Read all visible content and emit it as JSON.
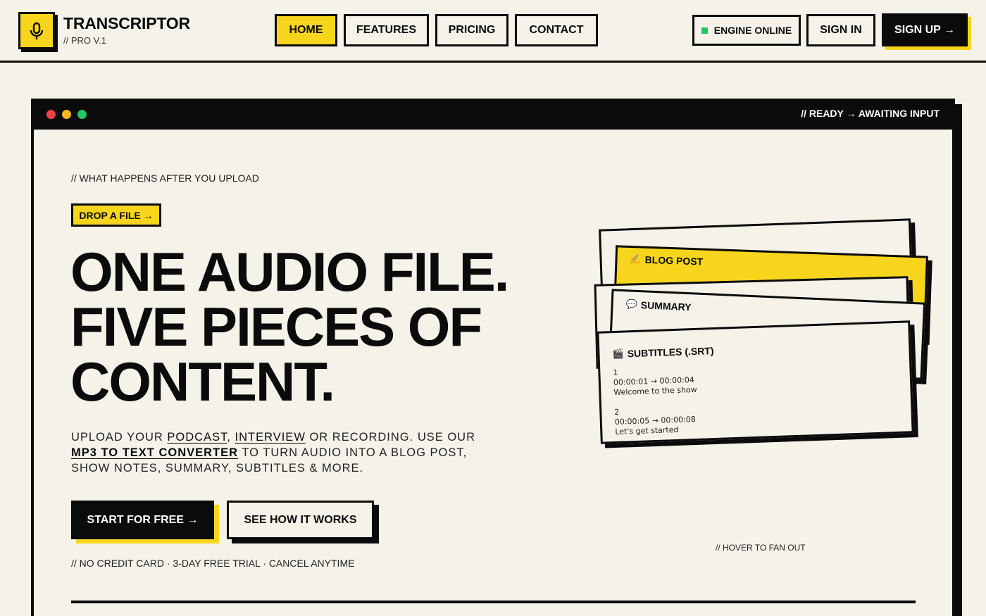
{
  "brand": {
    "name": "TRANSCRIPTOR",
    "sub": "// PRO V.1"
  },
  "nav": [
    {
      "label": "HOME",
      "active": true
    },
    {
      "label": "FEATURES",
      "active": false
    },
    {
      "label": "PRICING",
      "active": false
    },
    {
      "label": "CONTACT",
      "active": false
    }
  ],
  "header_right": {
    "engine_status": "ENGINE ONLINE",
    "sign_in": "SIGN IN",
    "sign_up": "SIGN UP →"
  },
  "window": {
    "status": "// READY → AWAITING INPUT"
  },
  "hero": {
    "eyebrow": "// WHAT HAPPENS AFTER YOU UPLOAD",
    "drop_label": "DROP A FILE →",
    "headline": [
      "ONE AUDIO FILE.",
      "FIVE PIECES OF",
      "CONTENT."
    ],
    "desc": {
      "t1": "UPLOAD YOUR ",
      "link1": "PODCAST",
      "t2": ", ",
      "link2": "INTERVIEW",
      "t3": " OR RECORDING. USE OUR ",
      "link3": "MP3 TO TEXT CONVERTER",
      "t4": " TO TURN AUDIO INTO A BLOG POST, SHOW NOTES, SUMMARY, SUBTITLES & MORE."
    },
    "cta_primary": "START FOR FREE →",
    "cta_secondary": "SEE HOW IT WORKS",
    "fine_print": "// NO CREDIT CARD · 3-DAY FREE TRIAL · CANCEL ANYTIME"
  },
  "cards": {
    "blog": {
      "icon": "✍️",
      "title": "BLOG POST"
    },
    "summary": {
      "icon": "💬",
      "title": "SUMMARY"
    },
    "subtitles": {
      "icon": "🎬",
      "title": "SUBTITLES (.SRT)",
      "lines": [
        "1",
        "00:00:01 → 00:00:04",
        "Welcome to the show",
        "2",
        "00:00:05 → 00:00:08",
        "Let's get started"
      ]
    },
    "hint": "// HOVER TO FAN OUT"
  },
  "colors": {
    "accent": "#f7d51d",
    "ink": "#0b0b0b",
    "paper": "#f5f2ea",
    "online": "#22c55e"
  }
}
